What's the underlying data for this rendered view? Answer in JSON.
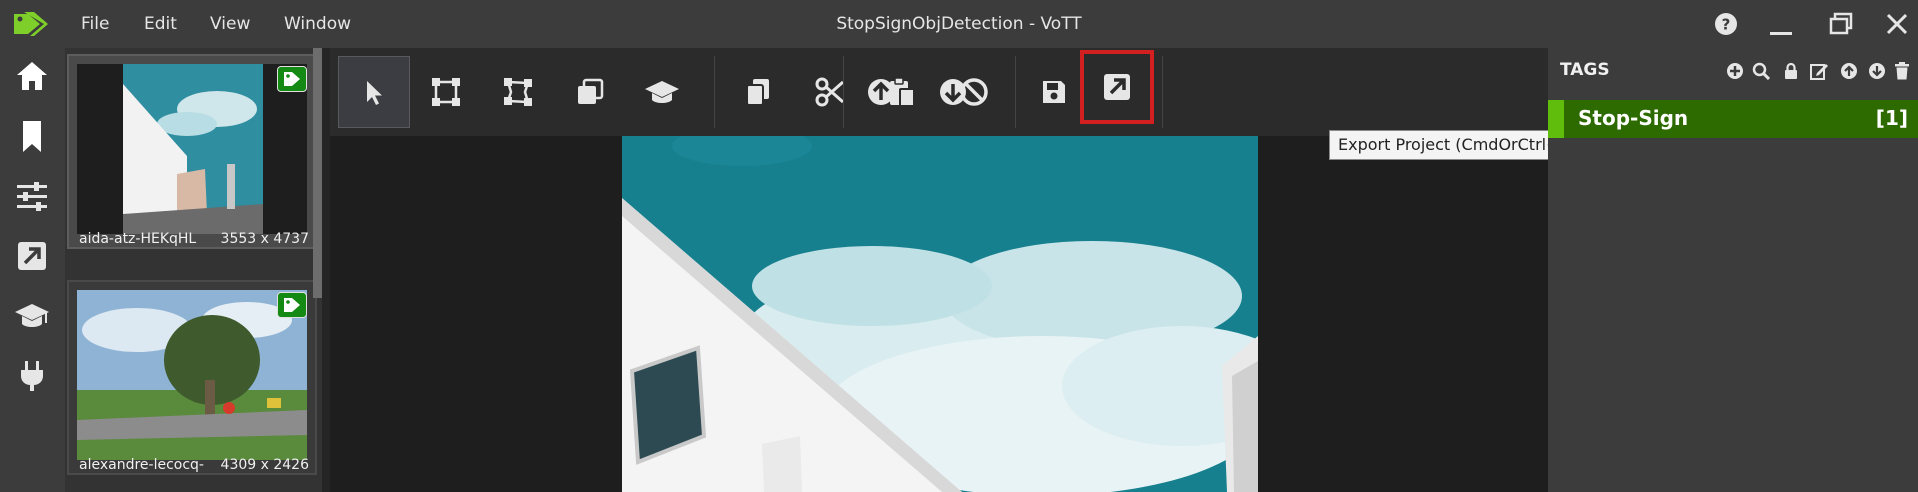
{
  "window": {
    "title": "StopSignObjDetection - VoTT",
    "menu": [
      "File",
      "Edit",
      "View",
      "Window"
    ]
  },
  "nav": {
    "icons": [
      "home-icon",
      "bookmark-icon",
      "sliders-icon",
      "export-icon",
      "graduation-cap-icon",
      "plug-icon"
    ]
  },
  "assets": [
    {
      "name": "aida-atz-HEKqHL",
      "size": "3553 x 4737",
      "tagged": true
    },
    {
      "name": "alexandre-lecocq-...",
      "size": "4309 x 2426",
      "tagged": true
    }
  ],
  "toolbar": {
    "groups": [
      [
        "select-pointer-icon",
        "draw-rectangle-icon",
        "draw-polygon-icon",
        "copy-rectangle-icon",
        "active-learning-icon"
      ],
      [
        "copy-icon",
        "cut-icon",
        "paste-icon",
        "clear-icon"
      ],
      [
        "previous-asset-icon",
        "next-asset-icon"
      ],
      [
        "save-icon",
        "export-icon"
      ]
    ],
    "tooltip": "Export Project (CmdOrCtrl+E)"
  },
  "tags": {
    "title": "TAGS",
    "items": [
      {
        "name": "Stop-Sign",
        "count": "[1]",
        "color": "#61bd0c"
      }
    ]
  },
  "colors": {
    "accent": "#61bd0c",
    "tag_row_bg": "#2d6a00",
    "highlight_border": "#d21f1f",
    "badge_green": "#148a14"
  }
}
